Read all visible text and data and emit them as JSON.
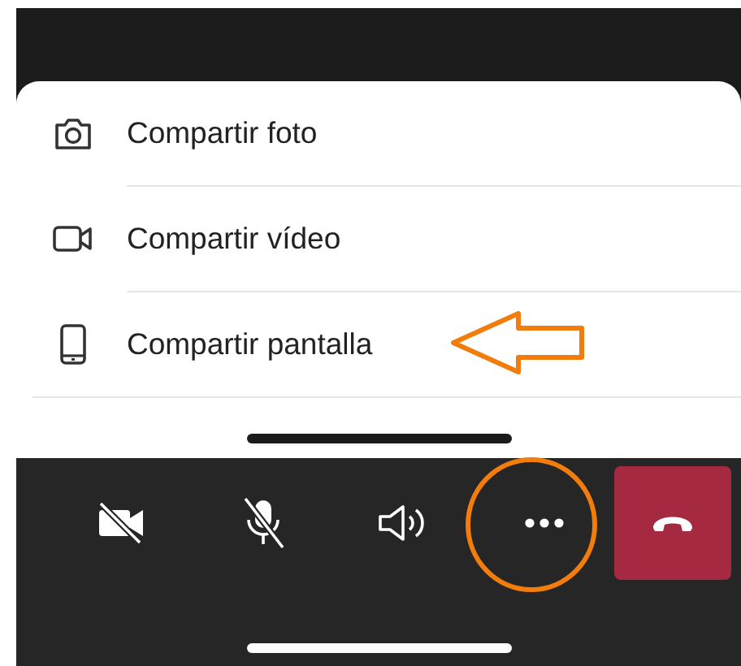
{
  "share_menu": [
    {
      "kind": "camera",
      "label": "Compartir foto"
    },
    {
      "kind": "video",
      "label": "Compartir vídeo"
    },
    {
      "kind": "phone",
      "label": "Compartir pantalla"
    }
  ],
  "call_controls": [
    {
      "kind": "camera-off"
    },
    {
      "kind": "mic-off"
    },
    {
      "kind": "speaker"
    },
    {
      "kind": "more"
    },
    {
      "kind": "hang-up"
    }
  ]
}
